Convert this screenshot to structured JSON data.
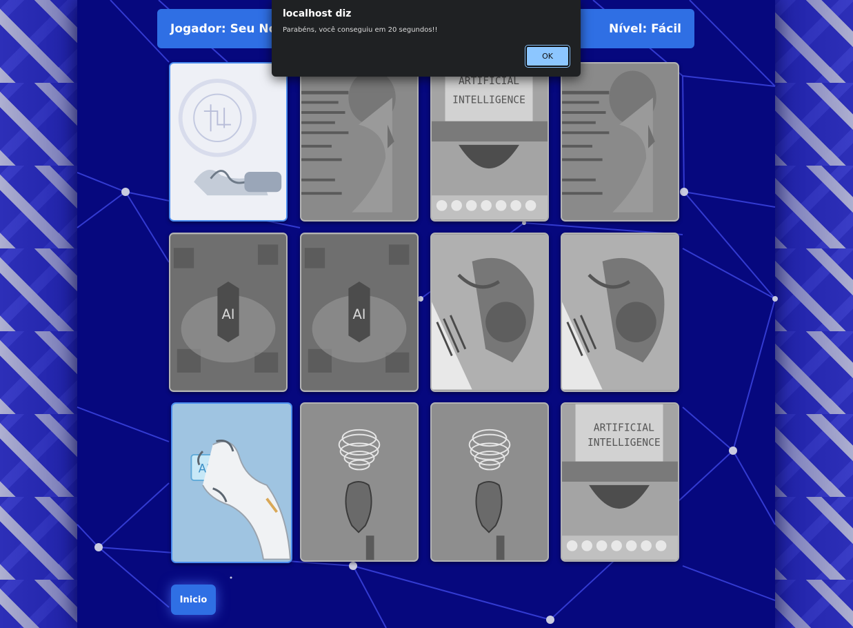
{
  "header": {
    "player": "Jogador: Seu Nom",
    "level": "Nível: Fácil"
  },
  "board": {
    "cards": [
      {
        "id": "brain-hand",
        "state": "revealed"
      },
      {
        "id": "robot-code",
        "state": "matched"
      },
      {
        "id": "typewriter-ai",
        "state": "matched",
        "text": "ARTIFICIAL INTELLIGENCE"
      },
      {
        "id": "robot-code",
        "state": "matched"
      },
      {
        "id": "ai-city",
        "state": "matched"
      },
      {
        "id": "ai-city",
        "state": "matched"
      },
      {
        "id": "robot-piano",
        "state": "matched"
      },
      {
        "id": "robot-piano",
        "state": "matched"
      },
      {
        "id": "ai-chip-hand",
        "state": "revealed",
        "text": "AI"
      },
      {
        "id": "light-bulb-hand",
        "state": "matched"
      },
      {
        "id": "light-bulb-hand",
        "state": "matched"
      },
      {
        "id": "typewriter-ai",
        "state": "matched",
        "text": "ARTIFICIAL INTELLIGENCE"
      }
    ]
  },
  "footer": {
    "home_button": "Inicio"
  },
  "alert": {
    "title": "localhost diz",
    "message": "Parabéns, você conseguiu em 20 segundos!!",
    "ok_label": "OK"
  },
  "colors": {
    "background": "#06087e",
    "accent": "#2f6fe4",
    "dialog_bg": "#1f2123",
    "ok_button": "#8cc6ff"
  }
}
